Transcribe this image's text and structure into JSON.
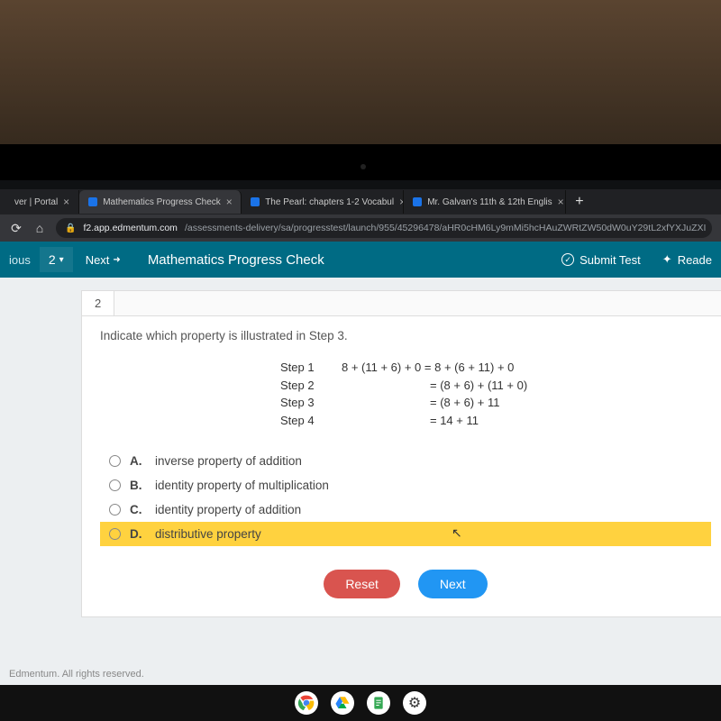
{
  "tabs": [
    {
      "label": "ver | Portal",
      "active": false
    },
    {
      "label": "Mathematics Progress Check",
      "active": true
    },
    {
      "label": "The Pearl: chapters 1-2 Vocabul",
      "active": false
    },
    {
      "label": "Mr. Galvan's 11th & 12th Englis",
      "active": false
    }
  ],
  "address": {
    "host": "f2.app.edmentum.com",
    "path": "/assessments-delivery/sa/progresstest/launch/955/45296478/aHR0cHM6Ly9mMi5hcHAuZWRtZW50dW0uY29tL2xfYXJuZXI"
  },
  "header": {
    "prev": "ious",
    "qnum": "2",
    "next": "Next",
    "title": "Mathematics Progress Check",
    "submit": "Submit Test",
    "reader": "Reade"
  },
  "question": {
    "tab": "2",
    "prompt": "Indicate which property is illustrated in Step 3.",
    "steps": [
      {
        "label": "Step 1",
        "expr": "8 + (11 + 6) + 0 = 8 + (6 + 11) + 0"
      },
      {
        "label": "Step 2",
        "expr": "= (8 + 6) + (11 + 0)"
      },
      {
        "label": "Step 3",
        "expr": "= (8 + 6) + 11"
      },
      {
        "label": "Step 4",
        "expr": "= 14 + 11"
      }
    ],
    "choices": [
      {
        "letter": "A.",
        "text": "inverse property of addition",
        "highlight": false
      },
      {
        "letter": "B.",
        "text": "identity property of multiplication",
        "highlight": false
      },
      {
        "letter": "C.",
        "text": "identity property of addition",
        "highlight": false
      },
      {
        "letter": "D.",
        "text": "distributive property",
        "highlight": true
      }
    ],
    "reset": "Reset",
    "nextbtn": "Next"
  },
  "footer": "Edmentum. All rights reserved."
}
